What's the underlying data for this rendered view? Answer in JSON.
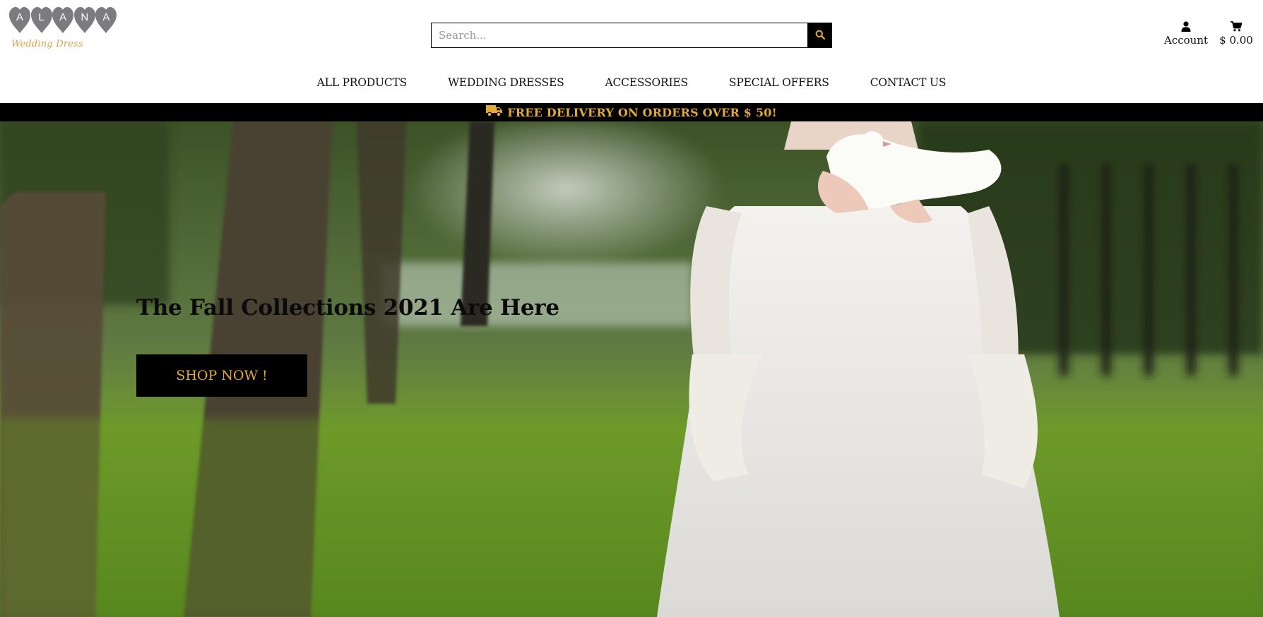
{
  "brand": {
    "logo_letters": [
      "A",
      "L",
      "A",
      "N",
      "A"
    ],
    "tagline": "Wedding Dress",
    "heart_color": "#7b7b80",
    "tagline_color": "#d3a246"
  },
  "search": {
    "placeholder": "Search...",
    "value": "",
    "button_icon": "search-icon"
  },
  "account": {
    "label": "Account",
    "icon": "user-icon"
  },
  "cart": {
    "total": "$ 0.00",
    "icon": "shopping-cart-icon"
  },
  "nav": {
    "items": [
      {
        "label": "ALL PRODUCTS"
      },
      {
        "label": "WEDDING DRESSES"
      },
      {
        "label": "ACCESSORIES"
      },
      {
        "label": "SPECIAL OFFERS"
      },
      {
        "label": "CONTACT US"
      }
    ]
  },
  "promo": {
    "icon": "truck-icon",
    "text": "FREE DELIVERY ON ORDERS OVER $ 50!",
    "color": "#e3a93a"
  },
  "hero": {
    "title": "The Fall Collections 2021 Are Here",
    "button_label": "SHOP NOW !",
    "button_text_color": "#e3a93a"
  }
}
